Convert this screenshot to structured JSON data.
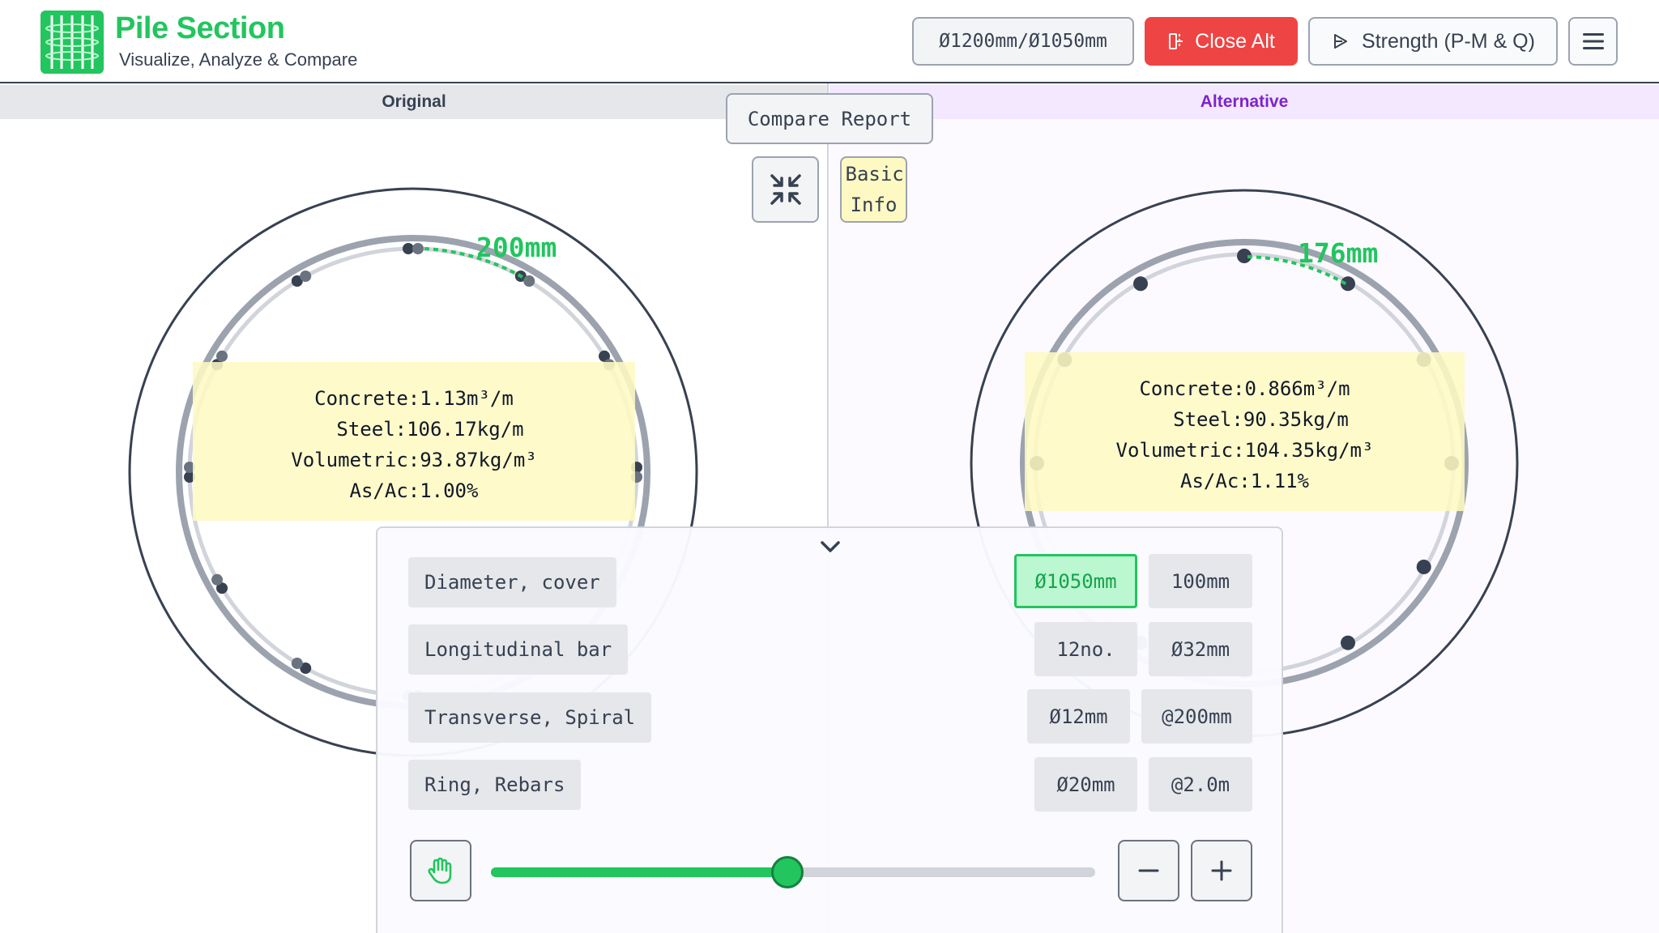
{
  "header": {
    "app_title": "Pile Section",
    "app_subtitle": "Visualize, Analyze & Compare",
    "size_button": "Ø1200mm/Ø1050mm",
    "close_alt_button": "Close Alt",
    "strength_button": "Strength (P-M & Q)",
    "logo_icon": "pile-cage-logo",
    "menu_icon": "hamburger-icon"
  },
  "labels": {
    "original": "Original",
    "alternative": "Alternative"
  },
  "toolbar": {
    "compare_report": "Compare Report",
    "basic_info": "Basic Info",
    "collapse_icon": "collapse-arrows-icon"
  },
  "original": {
    "spacing_label": "200mm",
    "bar_count": 12,
    "concrete": "Concrete:1.13m³/m",
    "steel": "Steel:106.17kg/m",
    "volumetric": "Volumetric:93.87kg/m³",
    "as_ac": "As/Ac:1.00%"
  },
  "alternative": {
    "spacing_label": "176mm",
    "bar_count": 12,
    "concrete": "Concrete:0.866m³/m",
    "steel": "Steel:90.35kg/m",
    "volumetric": "Volumetric:104.35kg/m³",
    "as_ac": "As/Ac:1.11%"
  },
  "panel": {
    "rows": [
      {
        "label": "Diameter, cover",
        "value1": "Ø1050mm",
        "value2": "100mm"
      },
      {
        "label": "Longitudinal bar",
        "value1": "12no.",
        "value2": "Ø32mm"
      },
      {
        "label": "Transverse, Spiral",
        "value1": "Ø12mm",
        "value2": "@200mm"
      },
      {
        "label": "Ring, Rebars",
        "value1": "Ø20mm",
        "value2": "@2.0m"
      }
    ],
    "slider_value": 0.49,
    "icons": [
      "chevron-down-icon",
      "hand-icon",
      "minus-icon",
      "plus-icon"
    ]
  },
  "colors": {
    "accent_green": "#22c55e",
    "close_red": "#ef4444",
    "alt_purple": "#7e22ce",
    "info_yellow": "#fef9c3"
  }
}
